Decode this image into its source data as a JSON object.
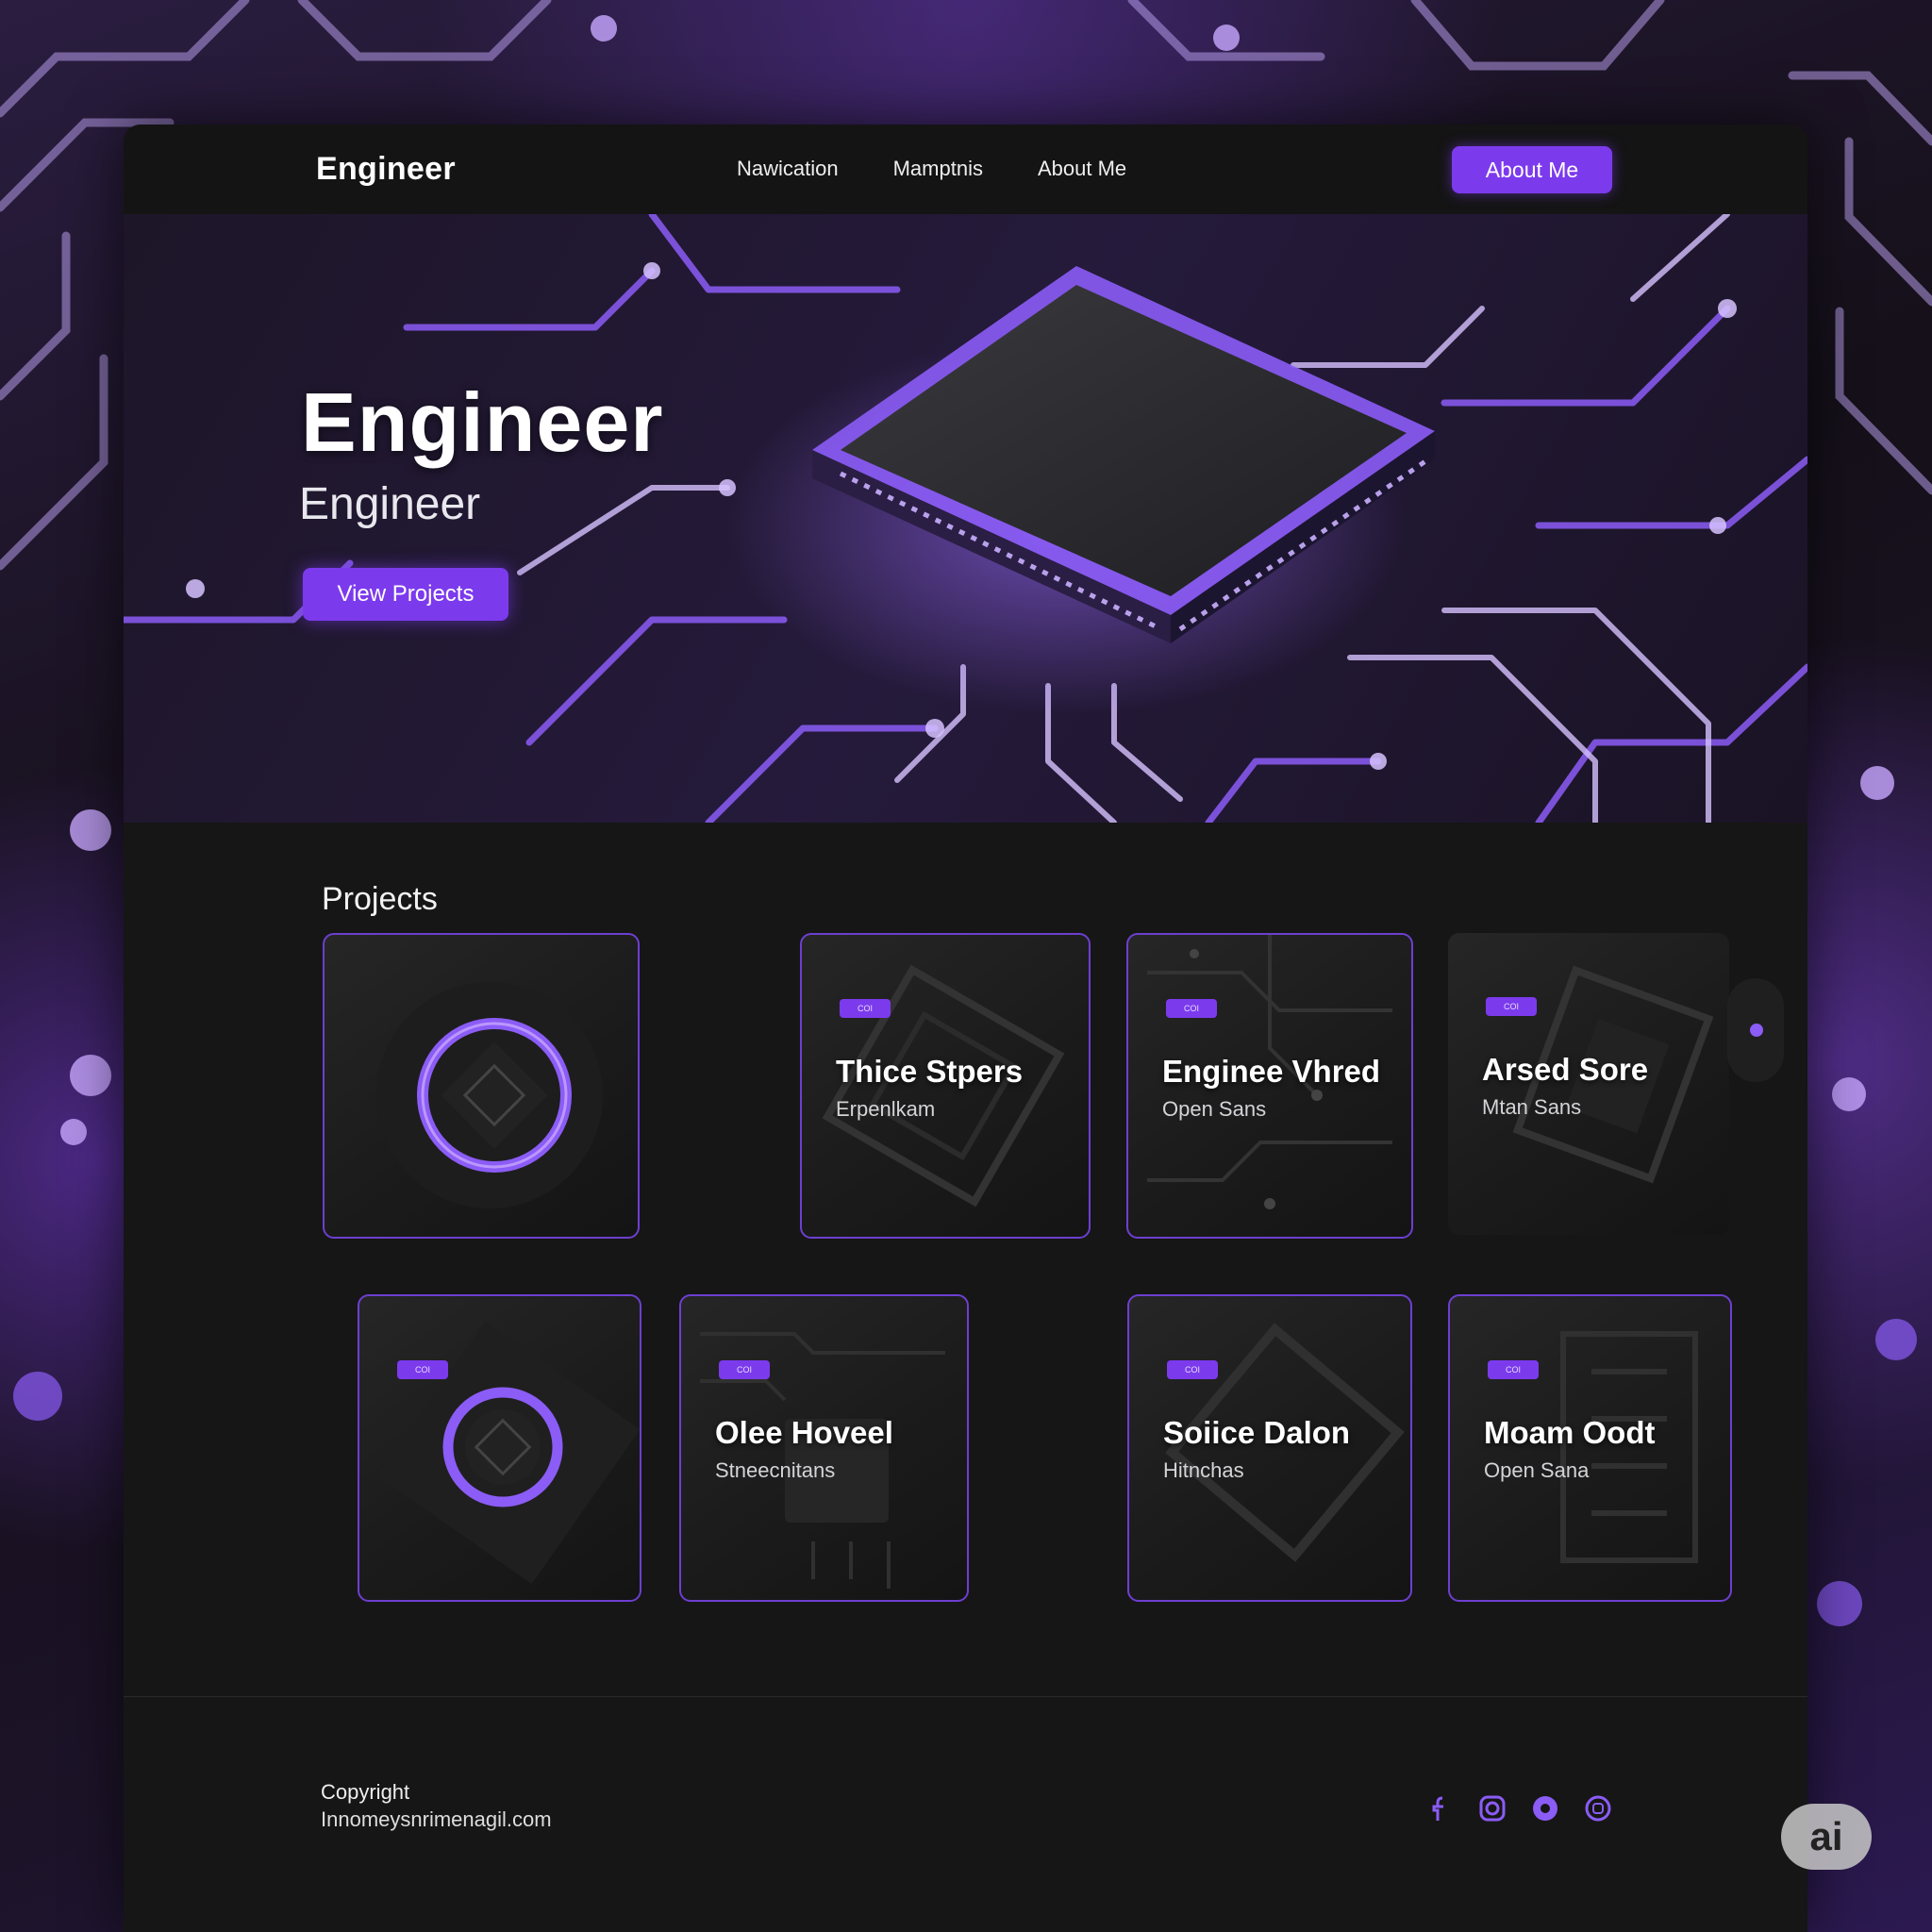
{
  "header": {
    "brand": "Engineer",
    "nav": [
      "Nawication",
      "Mamptnis",
      "About Me"
    ],
    "cta": "About Me"
  },
  "hero": {
    "title": "Engineer",
    "subtitle": "Engineer",
    "button": "View Projects"
  },
  "projects": {
    "heading": "Projects",
    "cards": [
      {
        "tag": "",
        "title": "",
        "subtitle": ""
      },
      {
        "tag": "COI",
        "title": "Thice Stpers",
        "subtitle": "Erpenlkam"
      },
      {
        "tag": "COI",
        "title": "Enginee Vhred",
        "subtitle": "Open Sans"
      },
      {
        "tag": "COI",
        "title": "Arsed Sore",
        "subtitle": "Mtan Sans"
      },
      {
        "tag": "COI",
        "title": "",
        "subtitle": ""
      },
      {
        "tag": "COI",
        "title": "Olee Hoveel",
        "subtitle": "Stneecnitans"
      },
      {
        "tag": "COI",
        "title": "Soiice Dalon",
        "subtitle": "Hitnchas"
      },
      {
        "tag": "COI",
        "title": "Moam Oodt",
        "subtitle": "Open Sana"
      }
    ]
  },
  "footer": {
    "copyright": "Copyright",
    "email": "Innomeysnrimenagil.com",
    "socials": [
      "facebook-icon",
      "instagram-icon",
      "circle-icon",
      "camera-icon"
    ]
  },
  "badge": "ai",
  "colors": {
    "accent": "#7c3aed",
    "background": "#161616"
  }
}
